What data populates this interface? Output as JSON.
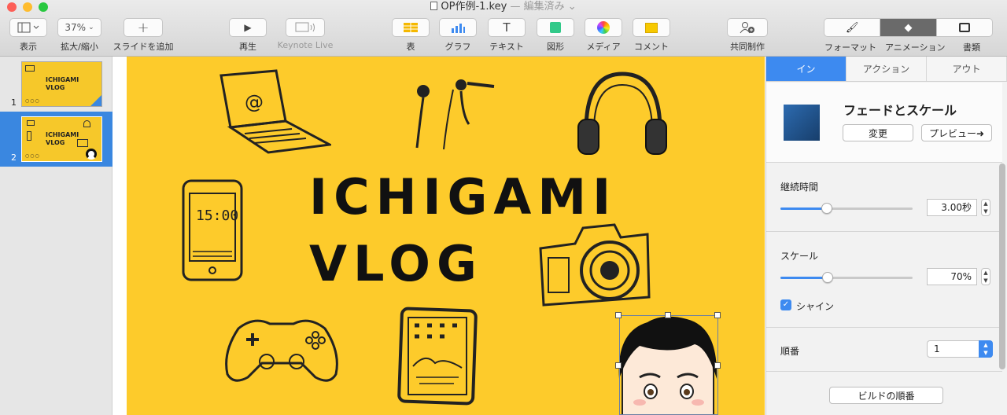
{
  "window": {
    "title": "OP作例-1.key",
    "status": "— 編集済み ⌄",
    "colors": {
      "close": "#fd5f57",
      "minimize": "#febc2e",
      "zoom": "#29c840"
    }
  },
  "toolbar": {
    "view_label": "表示",
    "zoom_value": "37%",
    "zoom_label": "拡大/縮小",
    "add_slide_label": "スライドを追加",
    "play_label": "再生",
    "keynote_live_label": "Keynote Live",
    "table_label": "表",
    "chart_label": "グラフ",
    "text_label": "テキスト",
    "text_glyph": "T",
    "shape_label": "図形",
    "media_label": "メディア",
    "comment_label": "コメント",
    "collaborate_label": "共同制作",
    "format_label": "フォーマット",
    "animate_label": "アニメーション",
    "document_label": "書類"
  },
  "navigator": {
    "slides": [
      {
        "number": "1",
        "line1": "ICHIGAMI",
        "line2": "VLOG"
      },
      {
        "number": "2",
        "line1": "ICHIGAMI",
        "line2": "VLOG"
      }
    ],
    "selected_color": "#3a87e0"
  },
  "slide": {
    "title_line1": "ICHIGAMI",
    "title_line2": "VLOG",
    "background": "#fdcb2b",
    "phone_time": "15:00",
    "laptop_glyph": "@"
  },
  "inspector": {
    "tabs": [
      "イン",
      "アクション",
      "アウト"
    ],
    "active_tab": "イン",
    "effect_name": "フェードとスケール",
    "effect_color": "#1f4f86",
    "change_button": "変更",
    "preview_button": "プレビュー➜",
    "duration_label": "継続時間",
    "duration_value": "3.00秒",
    "duration_fraction": 0.35,
    "scale_label": "スケール",
    "scale_value": "70%",
    "scale_fraction": 0.36,
    "shine_label": "シャイン",
    "shine_checked": true,
    "order_label": "順番",
    "order_value": "1",
    "build_order_button": "ビルドの順番",
    "accent": "#3d8af0"
  }
}
